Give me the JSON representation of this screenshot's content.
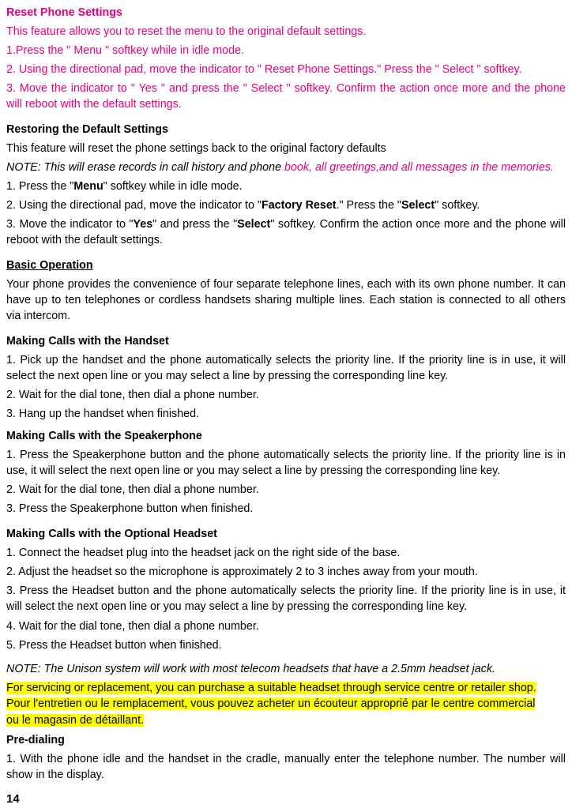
{
  "reset": {
    "title": "Reset Phone Settings",
    "intro": "This feature allows you to reset the menu to the original default  settings.",
    "s1": "1.Press the \" Menu \" softkey while in idle mode.",
    "s2": "2. Using the directional pad, move the indicator to \" Reset Phone Settings.\" Press the \" Select \" softkey.",
    "s3": "3. Move the indicator to \" Yes \" and press the \" Select \" softkey. Confirm the action once more and the phone will reboot with the default settings."
  },
  "restore": {
    "title": "Restoring the Default Settings",
    "intro": "This feature will reset the phone settings back to the original factory defaults",
    "note_prefix": "NOTE:  This will erase records in call history and phone ",
    "note_magenta": "book, all greetings,and all messages in the memories.",
    "s1a": "1. Press the \"",
    "s1b": "Menu",
    "s1c": "\" softkey while in idle mode.",
    "s2a": "2. Using the directional pad, move the indicator to \"",
    "s2b": "Factory Reset",
    "s2c": ".\"  Press the \"",
    "s2d": "Select",
    "s2e": "\" softkey.",
    "s3a": "3. Move the indicator to \"",
    "s3b": "Yes",
    "s3c": "\" and press the \"",
    "s3d": "Select",
    "s3e": "\" softkey.  Confirm the action once more and the phone will reboot with the default settings."
  },
  "basic": {
    "title": "Basic Operation",
    "body": "Your phone provides the convenience of four separate telephone lines, each with its own phone number.  It can have up to ten telephones or cordless handsets sharing multiple lines.  Each station is connected to all others via intercom."
  },
  "handset": {
    "title": "Making Calls with the Handset",
    "s1": "1. Pick up the handset and the phone automatically selects the priority line.  If the priority line is in use, it will select the next open line or you may select a line by pressing the corresponding line key.",
    "s2": "2. Wait for the dial tone, then dial a phone number.",
    "s3": "3. Hang up the handset when finished."
  },
  "speaker": {
    "title": "Making Calls with the Speakerphone",
    "s1": "1. Press the Speakerphone button and the phone automatically selects the priority line.  If the priority line is in use, it will select the next open line or you may select a line by pressing the corresponding line key.",
    "s2": "2. Wait for the dial tone, then dial a phone number.",
    "s3": "3. Press the Speakerphone button when finished."
  },
  "headset": {
    "title": "Making Calls with the Optional Headset",
    "s1": "1. Connect the headset plug into the headset jack on the right side of the base.",
    "s2": "2. Adjust the headset so the microphone is approximately 2 to 3 inches away from your mouth.",
    "s3": "3. Press the Headset button and the phone automatically selects the priority line.  If the priority line is in use, it will select the next open line or you may select a line by pressing the corresponding line key.",
    "s4": "4. Wait for the dial tone, then dial a phone number.",
    "s5": "5. Press the Headset button when finished.",
    "note": "NOTE:  The Unison system will work with most telecom headsets that have a 2.5mm headset jack.",
    "hl1": "For servicing or replacement, you can purchase a suitable headset through service centre or retailer shop.",
    "hl2": "Pour l'entretien ou le remplacement, vous pouvez acheter un écouteur approprié par le centre commercial",
    "hl3": "ou le magasin de détaillant."
  },
  "predial": {
    "title": "Pre-dialing",
    "s1": "1. With the phone idle and the handset in the cradle, manually enter the telephone number.  The number will show in the display."
  },
  "page": "14"
}
